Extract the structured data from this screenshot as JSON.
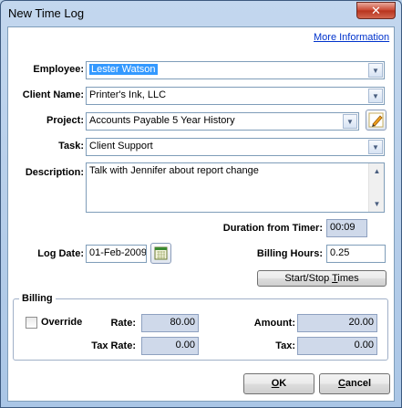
{
  "window": {
    "title": "New Time Log",
    "close_glyph": "✕"
  },
  "links": {
    "more_info": "More Information"
  },
  "form": {
    "employee": {
      "label": "Employee:",
      "value": "Lester Watson"
    },
    "client": {
      "label": "Client Name:",
      "value": "Printer's Ink, LLC"
    },
    "project": {
      "label": "Project:",
      "value": "Accounts Payable 5 Year History"
    },
    "task": {
      "label": "Task:",
      "value": "Client Support"
    },
    "description": {
      "label": "Description:",
      "value": "Talk with Jennifer about report change"
    },
    "duration": {
      "label": "Duration from Timer:",
      "value": "00:09"
    },
    "log_date": {
      "label": "Log Date:",
      "value": "01-Feb-2009"
    },
    "billing_hours": {
      "label": "Billing Hours:",
      "value": "0.25"
    },
    "start_stop": {
      "label_pre": "Start/Stop ",
      "label_ul": "T",
      "label_post": "imes"
    }
  },
  "billing": {
    "title": "Billing",
    "override": {
      "label": "Override",
      "checked": false
    },
    "rate": {
      "label": "Rate:",
      "value": "80.00"
    },
    "amount": {
      "label": "Amount:",
      "value": "20.00"
    },
    "tax_rate": {
      "label": "Tax Rate:",
      "value": "0.00"
    },
    "tax": {
      "label": "Tax:",
      "value": "0.00"
    }
  },
  "buttons": {
    "ok_ul": "O",
    "ok_rest": "K",
    "cancel_ul": "C",
    "cancel_rest": "ancel"
  },
  "icons": {
    "dropdown": "chevron-down-icon",
    "edit": "pencil-icon",
    "calendar": "calendar-icon"
  },
  "colors": {
    "selection": "#3399ff",
    "readonly_bg": "#cfd9ea",
    "link": "#0033cc"
  }
}
